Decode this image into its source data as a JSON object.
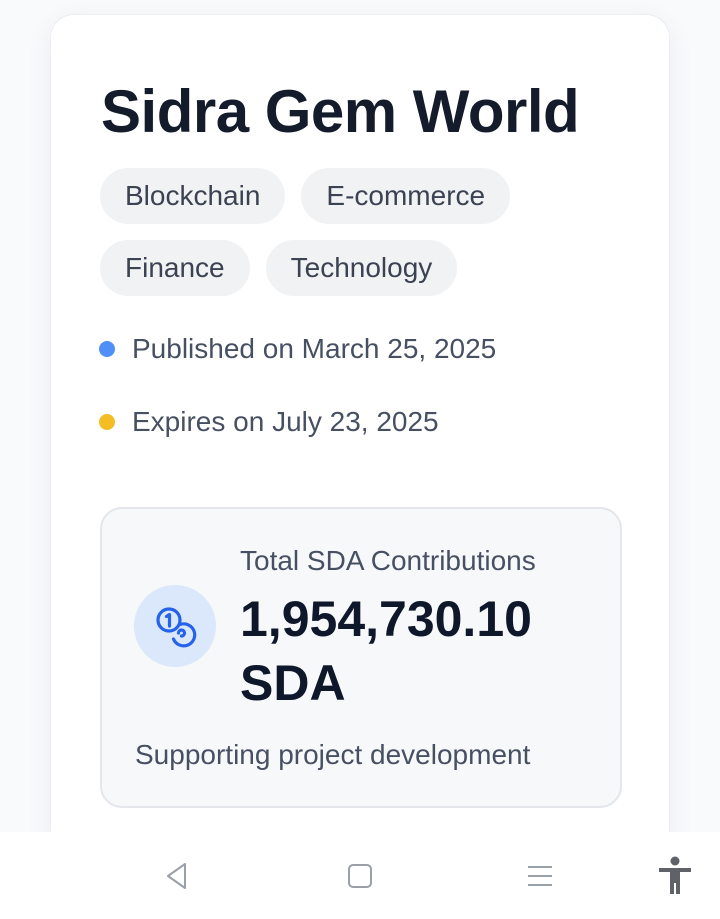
{
  "project": {
    "title": "Sidra Gem World",
    "tags": [
      [
        "Blockchain",
        "E-commerce"
      ],
      [
        "Finance",
        "Technology"
      ]
    ],
    "published": {
      "text": "Published on March 25, 2025",
      "dot_color": "#4f8ff7"
    },
    "expires": {
      "text": "Expires on July 23, 2025",
      "dot_color": "#f3bd23"
    }
  },
  "contributions": {
    "label": "Total SDA Contributions",
    "value": "1,954,730.10 SDA",
    "subtitle": "Supporting project development",
    "icon": "coins-icon",
    "accent_color": "#2563eb"
  },
  "navigation_bar": {
    "buttons": [
      "back-icon",
      "home-icon",
      "recents-icon",
      "accessibility-icon"
    ]
  }
}
